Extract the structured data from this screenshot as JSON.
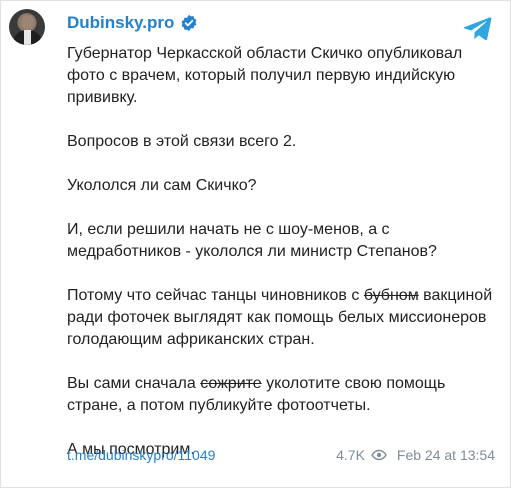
{
  "post": {
    "channel_name": "Dubinsky.pro",
    "paragraphs": [
      "Губернатор Черкасской области Скичко опубликовал фото с врачем, который получил первую индийскую прививку.",
      "Вопросов в этой связи всего 2.",
      "Укололся ли сам Скичко?",
      "И, если решили начать не с шоу-менов, а с медработников - укололся ли министр Степанов?"
    ],
    "p5": {
      "before": "Потому что сейчас танцы чиновников с ",
      "struck": "бубном",
      "after": " вакциной ради фоточек выглядят как помощь белых миссионеров голодающим африканских стран."
    },
    "p6": {
      "before": "Вы сами сначала ",
      "struck": "сожрите",
      "after": " уколотите свою помощь стране, а потом публикуйте фотоотчеты."
    },
    "closing": "А мы посмотрим.",
    "link": "t.me/dubinskypro/11049",
    "views": "4.7K",
    "timestamp": "Feb 24 at 13:54"
  },
  "icons": {
    "verified": "verified-badge-icon",
    "telegram": "telegram-logo-icon",
    "views": "eye-icon"
  },
  "colors": {
    "accent": "#2481cc",
    "text": "#222222",
    "muted": "#7f8c99"
  }
}
